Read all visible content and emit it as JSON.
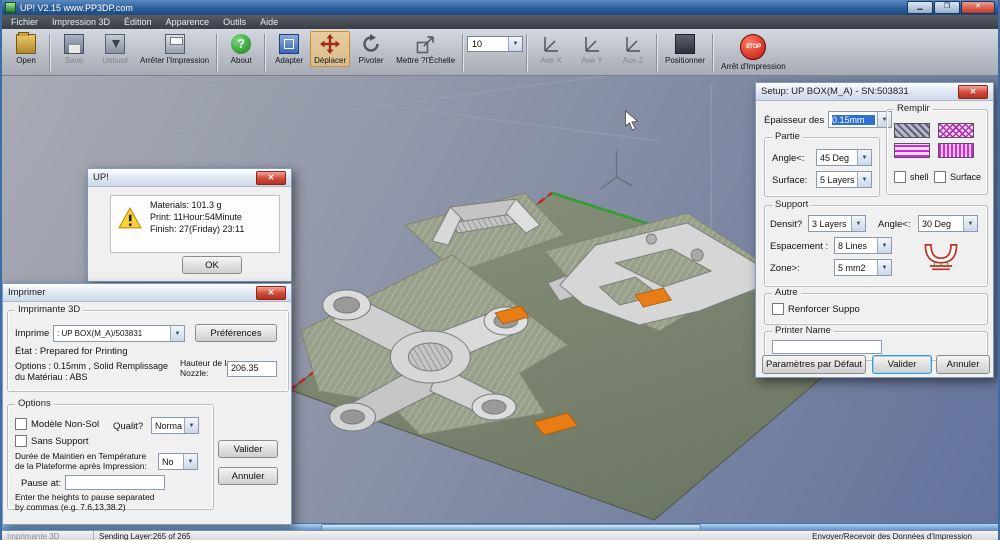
{
  "window": {
    "title": "UP!  V2.15 www.PP3DP.com"
  },
  "menu": {
    "items": [
      "Fichier",
      "Impression 3D",
      "Édition",
      "Apparence",
      "Outils",
      "Aide"
    ]
  },
  "toolbar": {
    "open": "Open",
    "save": "Save",
    "unload": "Unload",
    "stop_print": "Arrêter l'Impression",
    "about": "About",
    "fit": "Adapter",
    "move": "Déplacer",
    "rotate": "Pivoter",
    "scale": "Mettre ?l'Échelle",
    "scale_value": "10",
    "axis_x": "Axe X",
    "axis_y": "Axe Y",
    "axis_z": "Axe Z",
    "place": "Positionner",
    "estop": "Arrêt d'Impression",
    "stop_glyph": "STOP"
  },
  "msg_dialog": {
    "title": "UP!",
    "line1": "Materials: 101.3 g",
    "line2": "Print: 11Hour:54Minute",
    "line3": "Finish: 27(Friday) 23:11",
    "ok": "OK"
  },
  "print_dialog": {
    "title": "Imprimer",
    "printer_group": "Imprimante 3D",
    "printer_label": "Imprime",
    "printer_value": ": UP BOX(M_A)/503831",
    "preferences": "Préférences",
    "status": "État : Prepared for Printing",
    "options_line1": "Options : 0.15mm , Solid Remplissage",
    "options_line2": "du Matériau : ABS",
    "nozzle_label1": "Hauteur de la",
    "nozzle_label2": "Nozzle:",
    "nozzle_value": "206.35",
    "options_group": "Options",
    "no_raft": "Modèle Non-Sol",
    "quality_label": "Qualit?",
    "quality_value": "Normal",
    "no_support": "Sans Support",
    "platform_keep1": "Durée de Maintien en Température",
    "platform_keep2": "de la Plateforme après Impression:",
    "platform_keep_value": "No",
    "pause_label": "Pause at:",
    "pause_value": "",
    "pause_note1": "Enter the heights to pause separated",
    "pause_note2": "by commas (e.g. 7.6,13,38.2)",
    "ok": "Valider",
    "cancel": "Annuler"
  },
  "setup_dialog": {
    "title": "Setup: UP BOX(M_A) - SN:503831",
    "layer_label": "Épaisseur des",
    "layer_value": "0.15mm",
    "fill_group": "Remplir",
    "shell": "shell",
    "surface_cb": "Surface",
    "part_group": "Partie",
    "part_angle_label": "Angle<:",
    "part_angle_value": "45 Deg",
    "part_surface_label": "Surface:",
    "part_surface_value": "5 Layers",
    "support_group": "Support",
    "density_label": "Densit?",
    "density_value": "3 Layers",
    "support_angle_label": "Angle<:",
    "support_angle_value": "30 Deg",
    "space_label": "Espacement :",
    "space_value": "8 Lines",
    "area_label": "Zone>:",
    "area_value": "5 mm2",
    "other_group": "Autre",
    "reinforce": "Renforcer Suppo",
    "printer_name_group": "Printer Name",
    "printer_name_value": "",
    "defaults": "Paramètres par Défaut",
    "ok": "Valider",
    "cancel": "Annuler"
  },
  "statusbar": {
    "left": "Imprimante 3D",
    "sending": "Sending Layer:265 of 265",
    "right": "Envoyer/Recevoir des Données d'Impression"
  },
  "colors": {
    "accent_blue": "#3c6ea5",
    "platform_green": "#7b8570",
    "support_orange": "#e87d15",
    "edge_red": "#cc2418",
    "edge_green": "#2da02d"
  }
}
